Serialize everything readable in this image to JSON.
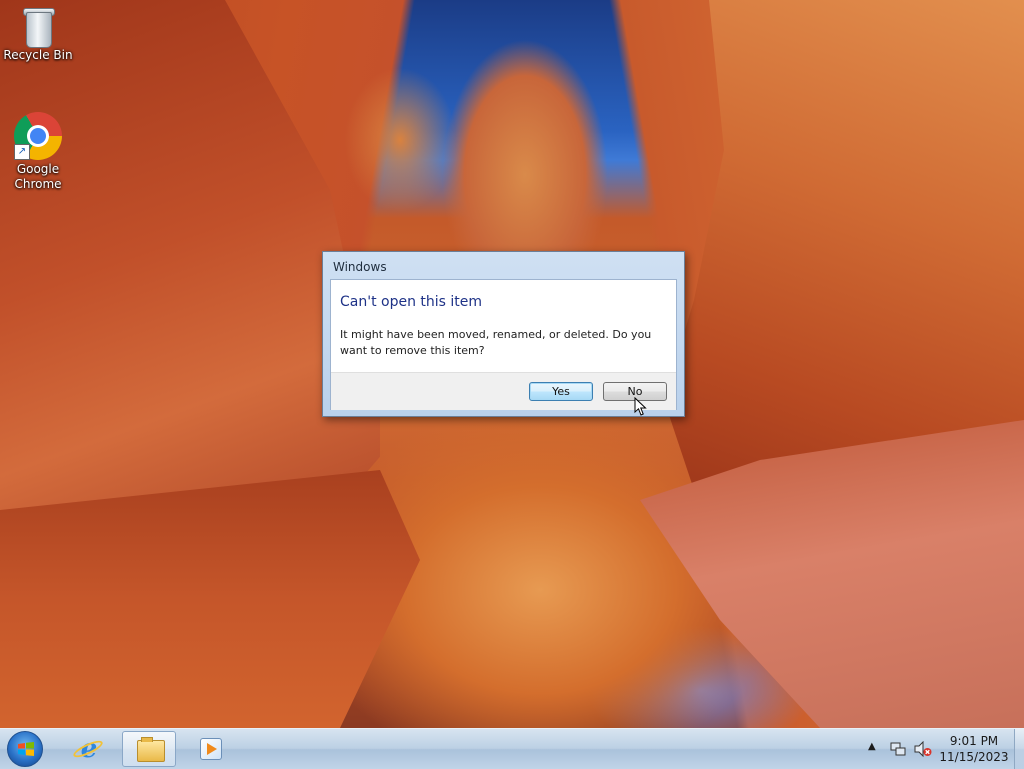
{
  "desktop": {
    "icons": [
      {
        "label": "Recycle Bin",
        "icon": "recycle-bin-icon"
      },
      {
        "label": "Google Chrome",
        "icon": "chrome-icon"
      }
    ]
  },
  "dialog": {
    "title": "Windows",
    "heading": "Can't open this item",
    "message": "It might have been moved, renamed, or deleted. Do you want to remove this item?",
    "yes_label": "Yes",
    "no_label": "No"
  },
  "taskbar": {
    "pinned": [
      {
        "name": "Internet Explorer",
        "icon": "internet-explorer-icon"
      },
      {
        "name": "Windows Explorer",
        "icon": "folder-icon",
        "active": true
      },
      {
        "name": "Windows Media Player",
        "icon": "media-player-icon"
      }
    ],
    "tray": {
      "time": "9:01 PM",
      "date": "11/15/2023",
      "icons": [
        "show-hidden-icons-arrow",
        "network-icon",
        "volume-muted-icon"
      ]
    }
  },
  "colors": {
    "dialog_heading": "#1e3287",
    "default_button_border": "#3c7fb1",
    "taskbar": "#bcd0e4"
  }
}
